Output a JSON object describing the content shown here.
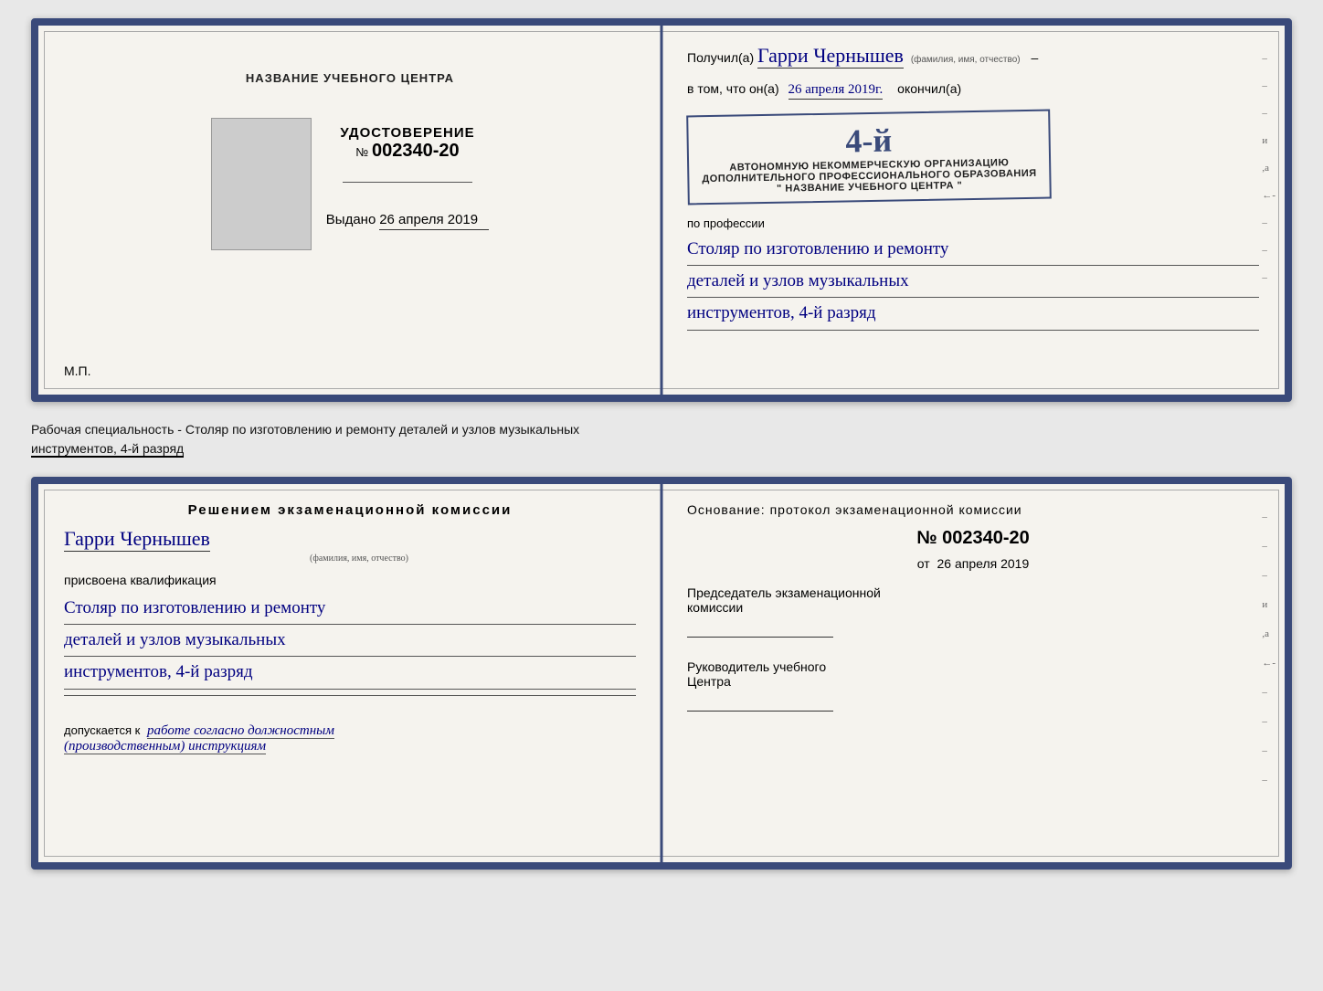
{
  "top_cert": {
    "left": {
      "title": "НАЗВАНИЕ УЧЕБНОГО ЦЕНТРА",
      "cert_label": "УДОСТОВЕРЕНИЕ",
      "cert_no_prefix": "№",
      "cert_number": "002340-20",
      "issued_label": "Выдано",
      "issued_date": "26 апреля 2019",
      "mp_label": "М.П."
    },
    "right": {
      "received_prefix": "Получил(а)",
      "received_name": "Гарри Чернышев",
      "name_hint": "(фамилия, имя, отчество)",
      "vtom_prefix": "в том, что он(а)",
      "date_val": "26 апреля 2019г.",
      "okoncil": "окончил(а)",
      "stamp_num": "4-й",
      "stamp_line1": "АВТОНОМНУЮ НЕКОММЕРЧЕСКУЮ ОРГАНИЗАЦИЮ",
      "stamp_line2": "ДОПОЛНИТЕЛЬНОГО ПРОФЕССИОНАЛЬНОГО ОБРАЗОВАНИЯ",
      "stamp_line3": "\" НАЗВАНИЕ УЧЕБНОГО ЦЕНТРА \"",
      "profession_label": "по профессии",
      "profession_line1": "Столяр по изготовлению и ремонту",
      "profession_line2": "деталей и узлов музыкальных",
      "profession_line3": "инструментов, 4-й разряд"
    }
  },
  "caption": {
    "text_normal": "Рабочая специальность - Столяр по изготовлению и ремонту деталей и узлов музыкальных",
    "text_underlined": "инструментов, 4-й разряд"
  },
  "bottom_cert": {
    "left": {
      "decision_header": "Решением  экзаменационной  комиссии",
      "person_name": "Гарри Чернышев",
      "name_hint": "(фамилия, имя, отчество)",
      "assigned_label": "присвоена квалификация",
      "qual_line1": "Столяр по изготовлению и ремонту",
      "qual_line2": "деталей и узлов музыкальных",
      "qual_line3": "инструментов, 4-й разряд",
      "dopusk_prefix": "допускается к",
      "dopusk_text": "работе согласно должностным",
      "dopusk_text2": "(производственным) инструкциям"
    },
    "right": {
      "basis_label": "Основание: протокол экзаменационной  комиссии",
      "protocol_prefix": "№",
      "protocol_number": "002340-20",
      "date_from_prefix": "от",
      "date_from_val": "26 апреля 2019",
      "chairman_label1": "Председатель экзаменационной",
      "chairman_label2": "комиссии",
      "director_label1": "Руководитель учебного",
      "director_label2": "Центра"
    }
  },
  "side_dashes": [
    "-",
    "-",
    "-",
    "и",
    ",а",
    "←",
    "-",
    "-",
    "-",
    "-"
  ]
}
